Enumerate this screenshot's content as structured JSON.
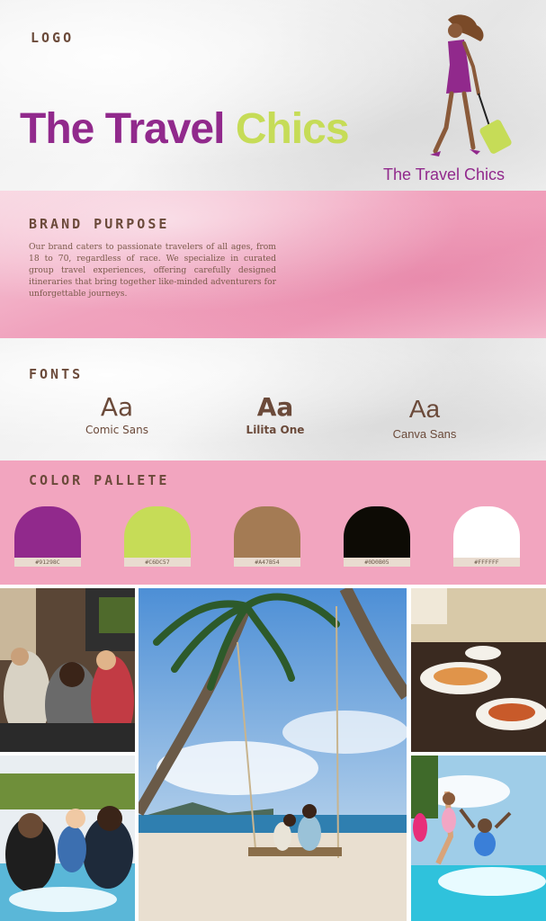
{
  "logo": {
    "heading": "LOGO",
    "wordmark_part1": "The",
    "wordmark_part2": "Travel",
    "wordmark_part3": "Chics",
    "caption": "The Travel Chics",
    "figure_icon": "woman-with-suitcase-icon"
  },
  "brand": {
    "heading": "BRAND PURPOSE",
    "text": "Our brand caters to passionate travelers of all ages, from 18 to 70, regardless of race. We specialize in curated group travel experiences, offering carefully designed itineraries that bring together like-minded adventurers for unforgettable journeys."
  },
  "fonts": {
    "heading": "FONTS",
    "samples": [
      {
        "aa": "Aa",
        "name": "Comic Sans"
      },
      {
        "aa": "Aa",
        "name": "Lilita One"
      },
      {
        "aa": "Aa",
        "name": "Canva Sans"
      }
    ]
  },
  "colors": {
    "heading": "COLOR PALLETE",
    "swatches": [
      {
        "hex": "#91298C",
        "label": "#91298C"
      },
      {
        "hex": "#C6DC57",
        "label": "#C6DC57"
      },
      {
        "hex": "#A47B54",
        "label": "#A47B54"
      },
      {
        "hex": "#0D0B05",
        "label": "#0D0B05"
      },
      {
        "hex": "#FFFFFF",
        "label": "#FFFFFF"
      }
    ]
  },
  "photos": [
    {
      "name": "group-selfie-photo"
    },
    {
      "name": "family-pool-photo"
    },
    {
      "name": "beach-swing-photo"
    },
    {
      "name": "dining-table-photo"
    },
    {
      "name": "kids-pool-jump-photo"
    }
  ]
}
